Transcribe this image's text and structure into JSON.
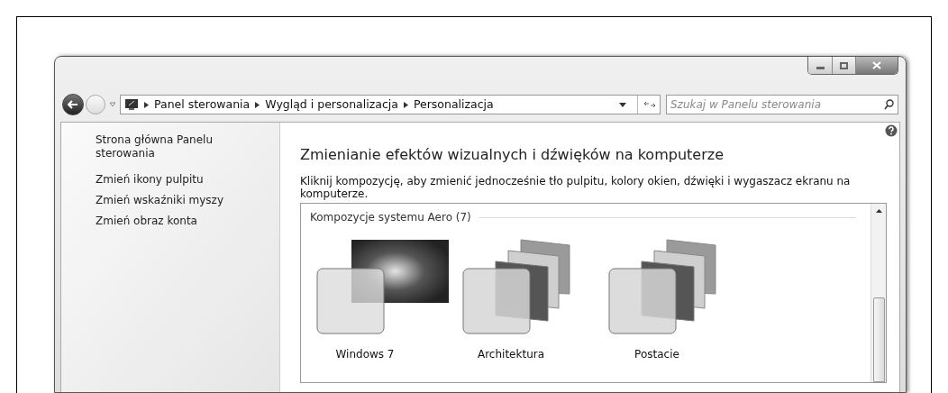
{
  "address_bar": {
    "breadcrumbs": [
      "Panel sterowania",
      "Wygląd i personalizacja",
      "Personalizacja"
    ],
    "search": {
      "placeholder": "Szukaj w Panelu sterowania"
    }
  },
  "sidebar": {
    "links": [
      "Strona główna Panelu sterowania",
      "Zmień ikony pulpitu",
      "Zmień wskaźniki myszy",
      "Zmień obraz konta"
    ]
  },
  "main": {
    "title": "Zmienianie efektów wizualnych i dźwięków na komputerze",
    "description": "Kliknij kompozycję, aby zmienić jednocześnie tło pulpitu, kolory okien, dźwięki i wygaszacz ekranu na komputerze.",
    "theme_group": {
      "title": "Kompozycje systemu Aero (7)",
      "themes": [
        {
          "name": "Windows 7",
          "kind": "single"
        },
        {
          "name": "Architektura",
          "kind": "stack"
        },
        {
          "name": "Postacie",
          "kind": "stack"
        }
      ]
    }
  }
}
